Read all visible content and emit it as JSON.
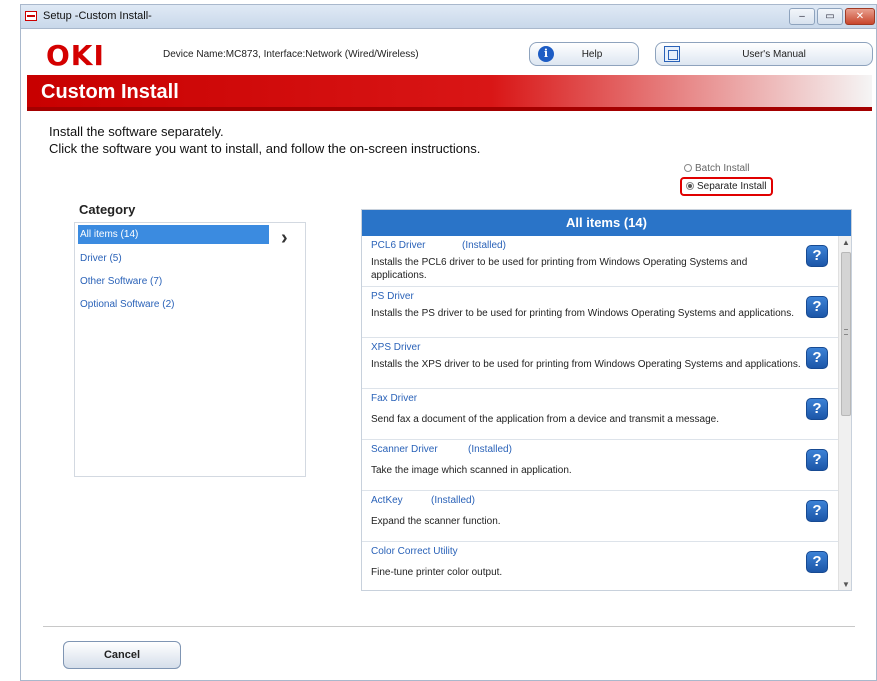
{
  "window": {
    "title": "Setup -Custom Install-",
    "controls": {
      "minimize": "–",
      "maximize": "▭",
      "close": "✕"
    }
  },
  "header": {
    "logo": "OKI",
    "device_info": "Device Name:MC873, Interface:Network (Wired/Wireless)",
    "help_label": "Help",
    "manual_label": "User's Manual"
  },
  "banner": {
    "title": "Custom Install"
  },
  "instructions": {
    "line1": "Install the software separately.",
    "line2": "Click the software you want to install, and follow the on-screen instructions."
  },
  "install_mode": {
    "options": [
      {
        "label": "Batch Install",
        "checked": false
      },
      {
        "label": "Separate Install",
        "checked": true
      }
    ]
  },
  "category": {
    "label": "Category",
    "items": [
      {
        "label": "All items (14)",
        "selected": true
      },
      {
        "label": "Driver (5)",
        "selected": false
      },
      {
        "label": "Other Software (7)",
        "selected": false
      },
      {
        "label": "Optional Software (2)",
        "selected": false
      }
    ]
  },
  "items_panel": {
    "header": "All items (14)",
    "items": [
      {
        "name": "PCL6 Driver",
        "status": "(Installed)",
        "desc": "Installs the PCL6 driver to be used for printing from Windows Operating Systems and applications."
      },
      {
        "name": "PS Driver",
        "status": "",
        "desc": "Installs the PS driver to be used for printing from Windows Operating Systems and applications."
      },
      {
        "name": "XPS Driver",
        "status": "",
        "desc": "Installs the XPS driver to be used for printing from Windows Operating Systems and applications."
      },
      {
        "name": "Fax Driver",
        "status": "",
        "desc": "Send fax a document of the application from a device and transmit a message."
      },
      {
        "name": "Scanner Driver",
        "status": "(Installed)",
        "desc": "Take the image which scanned in application."
      },
      {
        "name": "ActKey",
        "status": "(Installed)",
        "desc": "Expand the scanner function."
      },
      {
        "name": "Color Correct Utility",
        "status": "",
        "desc": "Fine-tune printer color output."
      }
    ]
  },
  "footer": {
    "cancel_label": "Cancel"
  },
  "colors": {
    "brand_red": "#d40000",
    "accent_blue": "#2a74c8",
    "highlight_red": "#e00000"
  }
}
